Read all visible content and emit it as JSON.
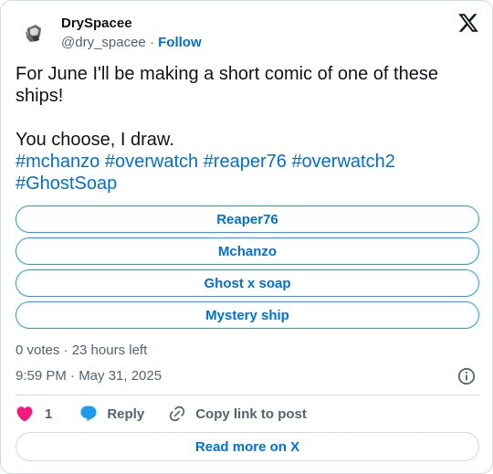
{
  "author": {
    "name": "DrySpacee",
    "handle": "@dry_spacee",
    "separator": "·",
    "follow_label": "Follow"
  },
  "icons": {
    "logo": "x-logo-icon",
    "like": "heart-icon",
    "reply": "speech-bubble-icon",
    "copy": "link-icon",
    "info": "info-icon"
  },
  "tweet": {
    "line1": "For June I'll be making a short comic of one of these ships!",
    "line2": "You choose, I draw.",
    "hashtags_line1": [
      "#mchanzo",
      "#overwatch",
      "#reaper76",
      "#overwatch2"
    ],
    "hashtags_line2": [
      "#GhostSoap"
    ]
  },
  "poll": {
    "options": [
      "Reaper76",
      "Mchanzo",
      "Ghost x soap",
      "Mystery ship"
    ],
    "meta": "0 votes · 23 hours left"
  },
  "timestamp": "9:59 PM · May 31, 2025",
  "actions": {
    "like_count": "1",
    "reply_label": "Reply",
    "copy_label": "Copy link to post"
  },
  "read_more_label": "Read more on X",
  "colors": {
    "text": "#0f1419",
    "secondary": "#536471",
    "link": "#006fd6",
    "poll_border": "#1d9bf0",
    "like": "#f91880",
    "reply": "#1d9bf0",
    "divider": "#cfd9de"
  }
}
